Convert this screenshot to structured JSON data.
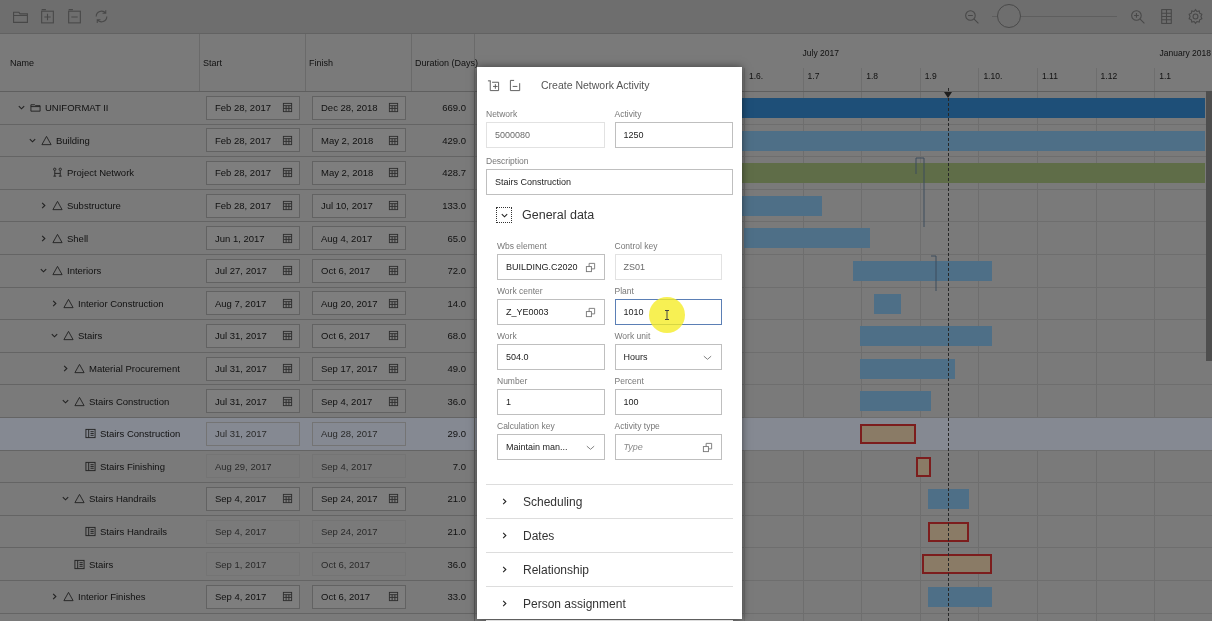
{
  "zoom_slider": {
    "level": 0.05
  },
  "table": {
    "columns": [
      "Name",
      "Start",
      "Finish",
      "Duration (Days)"
    ],
    "rows": [
      {
        "name": "UNIFORMAT II",
        "kind": "folder",
        "expanded": true,
        "selected": false,
        "start": "Feb 28, 2017",
        "finish": "Dec 28, 2018",
        "duration": "669.0",
        "children": [
          {
            "name": "Building",
            "kind": "wbs",
            "expanded": true,
            "selected": false,
            "start": "Feb 28, 2017",
            "finish": "May 2, 2018",
            "duration": "429.0",
            "children": [
              {
                "name": "Project Network",
                "kind": "network",
                "selected": false,
                "start": "Feb 28, 2017",
                "finish": "May 2, 2018",
                "duration": "428.7"
              },
              {
                "name": "Substructure",
                "kind": "wbs",
                "expanded": false,
                "selected": false,
                "start": "Feb 28, 2017",
                "finish": "Jul 10, 2017",
                "duration": "133.0"
              },
              {
                "name": "Shell",
                "kind": "wbs",
                "expanded": false,
                "selected": false,
                "start": "Jun 1, 2017",
                "finish": "Aug 4, 2017",
                "duration": "65.0"
              },
              {
                "name": "Interiors",
                "kind": "wbs",
                "expanded": true,
                "selected": false,
                "start": "Jul 27, 2017",
                "finish": "Oct 6, 2017",
                "duration": "72.0",
                "children": [
                  {
                    "name": "Interior Construction",
                    "kind": "wbs",
                    "expanded": false,
                    "selected": false,
                    "start": "Aug 7, 2017",
                    "finish": "Aug 20, 2017",
                    "duration": "14.0"
                  },
                  {
                    "name": "Stairs",
                    "kind": "wbs",
                    "expanded": true,
                    "selected": false,
                    "start": "Jul 31, 2017",
                    "finish": "Oct 6, 2017",
                    "duration": "68.0",
                    "children": [
                      {
                        "name": "Material Procurement",
                        "kind": "wbs",
                        "expanded": false,
                        "selected": false,
                        "start": "Jul 31, 2017",
                        "finish": "Sep 17, 2017",
                        "duration": "49.0"
                      },
                      {
                        "name": "Stairs Construction",
                        "kind": "wbs",
                        "expanded": true,
                        "selected": false,
                        "start": "Jul 31, 2017",
                        "finish": "Sep 4, 2017",
                        "duration": "36.0",
                        "children": [
                          {
                            "name": "Stairs Construction",
                            "kind": "activity",
                            "selected": true,
                            "start": "Jul 31, 2017",
                            "finish": "Aug 28, 2017",
                            "duration": "29.0"
                          },
                          {
                            "name": "Stairs Finishing",
                            "kind": "activity",
                            "selected": false,
                            "start": "Aug 29, 2017",
                            "finish": "Sep 4, 2017",
                            "duration": "7.0"
                          }
                        ]
                      },
                      {
                        "name": "Stairs Handrails",
                        "kind": "wbs",
                        "expanded": true,
                        "selected": false,
                        "start": "Sep 4, 2017",
                        "finish": "Sep 24, 2017",
                        "duration": "21.0",
                        "children": [
                          {
                            "name": "Stairs Handrails",
                            "kind": "activity",
                            "selected": false,
                            "start": "Sep 4, 2017",
                            "finish": "Sep 24, 2017",
                            "duration": "21.0"
                          }
                        ]
                      },
                      {
                        "name": "Stairs",
                        "kind": "activity",
                        "selected": false,
                        "start": "Sep 1, 2017",
                        "finish": "Oct 6, 2017",
                        "duration": "36.0"
                      }
                    ]
                  },
                  {
                    "name": "Interior Finishes",
                    "kind": "wbs",
                    "expanded": false,
                    "selected": false,
                    "start": "Sep 4, 2017",
                    "finish": "Oct 6, 2017",
                    "duration": "33.0"
                  }
                ]
              }
            ]
          }
        ]
      }
    ]
  },
  "timeline": {
    "months": [
      "July 2017",
      "January 2018"
    ],
    "ticks": [
      "1.6.",
      "1.7",
      "1.8",
      "1.9",
      "1.10.",
      "1.11",
      "1.12",
      "1.1"
    ]
  },
  "dialog": {
    "title": "Create Network Activity",
    "header_fields": [
      {
        "label": "Network",
        "value": "5000080",
        "kind": "input",
        "disabled": true,
        "focused": false
      },
      {
        "label": "Activity",
        "value": "1250",
        "kind": "input",
        "disabled": false,
        "focused": false
      }
    ],
    "description": {
      "label": "Description",
      "value": "Stairs Construction"
    },
    "sections": [
      {
        "title": "General data",
        "expanded": true,
        "fields": [
          {
            "label": "Wbs element",
            "value": "BUILDING.C2020",
            "kind": "value-help",
            "disabled": false,
            "focused": false
          },
          {
            "label": "Control key",
            "value": "ZS01",
            "kind": "input",
            "disabled": true,
            "focused": false
          },
          {
            "label": "Work center",
            "value": "Z_YE0003",
            "kind": "value-help",
            "disabled": false,
            "focused": false
          },
          {
            "label": "Plant",
            "value": "1010",
            "kind": "input",
            "disabled": false,
            "focused": true
          },
          {
            "label": "Work",
            "value": "504.0",
            "kind": "input",
            "disabled": false,
            "focused": false
          },
          {
            "label": "Work unit",
            "value": "Hours",
            "kind": "select",
            "disabled": false,
            "focused": false
          },
          {
            "label": "Number",
            "value": "1",
            "kind": "input",
            "disabled": false,
            "focused": false
          },
          {
            "label": "Percent",
            "value": "100",
            "kind": "input",
            "disabled": false,
            "focused": false
          },
          {
            "label": "Calculation key",
            "value": "Maintain man...",
            "kind": "select",
            "disabled": false,
            "focused": false
          },
          {
            "label": "Activity type",
            "placeholder": "Type",
            "kind": "value-help",
            "disabled": false,
            "focused": false
          }
        ]
      },
      {
        "title": "Scheduling",
        "expanded": false
      },
      {
        "title": "Dates",
        "expanded": false
      },
      {
        "title": "Relationship",
        "expanded": false
      },
      {
        "title": "Person assignment",
        "expanded": false
      }
    ]
  }
}
